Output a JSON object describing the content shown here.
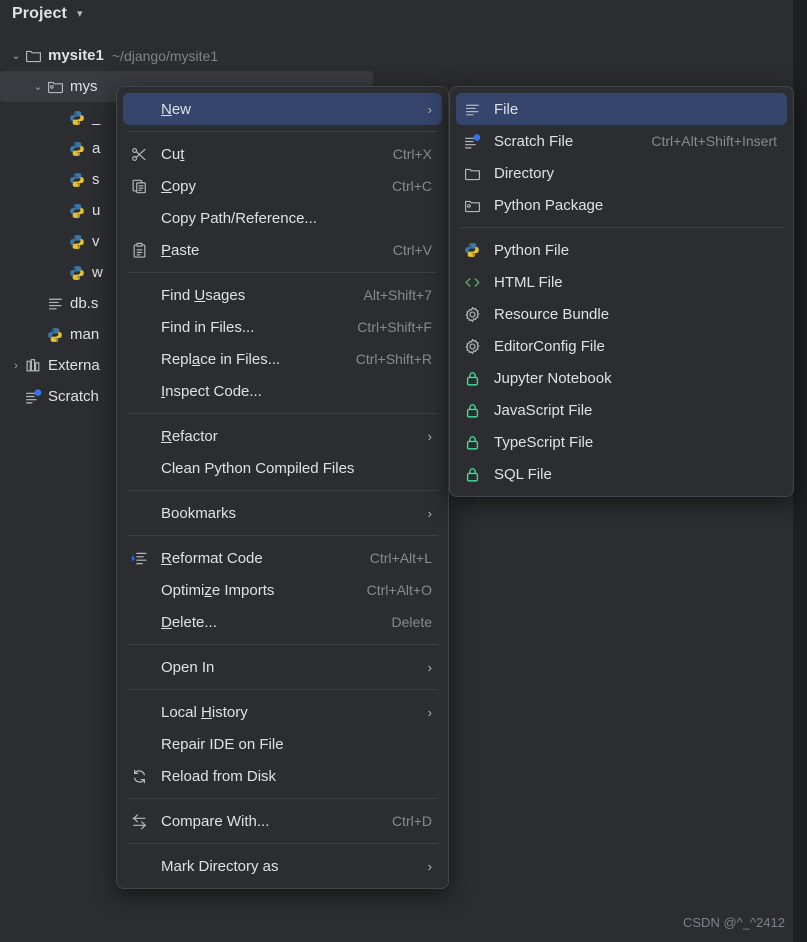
{
  "tool_window": {
    "title": "Project",
    "chevron": "chevron-down-icon"
  },
  "tree": [
    {
      "name": "mysite1",
      "path": "~/django/mysite1",
      "icon": "folder-icon",
      "twist": "expanded",
      "indent": 0,
      "bold": true,
      "selected": false
    },
    {
      "name": "mys",
      "path": "",
      "icon": "package-folder-icon",
      "twist": "expanded",
      "indent": 1,
      "bold": false,
      "selected": true
    },
    {
      "name": "_",
      "path": "",
      "icon": "python-icon",
      "twist": "none",
      "indent": 2,
      "bold": false,
      "selected": false
    },
    {
      "name": "a",
      "path": "",
      "icon": "python-icon",
      "twist": "none",
      "indent": 2,
      "bold": false,
      "selected": false
    },
    {
      "name": "s",
      "path": "",
      "icon": "python-icon",
      "twist": "none",
      "indent": 2,
      "bold": false,
      "selected": false
    },
    {
      "name": "u",
      "path": "",
      "icon": "python-icon",
      "twist": "none",
      "indent": 2,
      "bold": false,
      "selected": false
    },
    {
      "name": "v",
      "path": "",
      "icon": "python-icon",
      "twist": "none",
      "indent": 2,
      "bold": false,
      "selected": false
    },
    {
      "name": "w",
      "path": "",
      "icon": "python-icon",
      "twist": "none",
      "indent": 2,
      "bold": false,
      "selected": false
    },
    {
      "name": "db.s",
      "path": "",
      "icon": "file-lines-icon",
      "twist": "none",
      "indent": 1,
      "bold": false,
      "selected": false
    },
    {
      "name": "man",
      "path": "",
      "icon": "python-icon",
      "twist": "none",
      "indent": 1,
      "bold": false,
      "selected": false
    },
    {
      "name": "Externa",
      "path": "",
      "icon": "library-icon",
      "twist": "collapsed",
      "indent": 0,
      "bold": false,
      "selected": false
    },
    {
      "name": "Scratch",
      "path": "",
      "icon": "scratch-icon",
      "twist": "none",
      "indent": 0,
      "bold": false,
      "selected": false
    }
  ],
  "context_menu": [
    {
      "kind": "item",
      "label": "New",
      "mnemonic": "N",
      "icon": "",
      "shortcut": "",
      "arrow": true,
      "highlighted": true
    },
    {
      "kind": "separator"
    },
    {
      "kind": "item",
      "label": "Cut",
      "mnemonic": "t",
      "icon": "scissors-icon",
      "shortcut": "Ctrl+X",
      "arrow": false,
      "highlighted": false
    },
    {
      "kind": "item",
      "label": "Copy",
      "mnemonic": "C",
      "icon": "copy-icon",
      "shortcut": "Ctrl+C",
      "arrow": false,
      "highlighted": false
    },
    {
      "kind": "item",
      "label": "Copy Path/Reference...",
      "mnemonic": "",
      "icon": "",
      "shortcut": "",
      "arrow": false,
      "highlighted": false
    },
    {
      "kind": "item",
      "label": "Paste",
      "mnemonic": "P",
      "icon": "clipboard-icon",
      "shortcut": "Ctrl+V",
      "arrow": false,
      "highlighted": false
    },
    {
      "kind": "separator"
    },
    {
      "kind": "item",
      "label": "Find Usages",
      "mnemonic": "U",
      "icon": "",
      "shortcut": "Alt+Shift+7",
      "arrow": false,
      "highlighted": false
    },
    {
      "kind": "item",
      "label": "Find in Files...",
      "mnemonic": "",
      "icon": "",
      "shortcut": "Ctrl+Shift+F",
      "arrow": false,
      "highlighted": false
    },
    {
      "kind": "item",
      "label": "Replace in Files...",
      "mnemonic": "a",
      "icon": "",
      "shortcut": "Ctrl+Shift+R",
      "arrow": false,
      "highlighted": false
    },
    {
      "kind": "item",
      "label": "Inspect Code...",
      "mnemonic": "I",
      "icon": "",
      "shortcut": "",
      "arrow": false,
      "highlighted": false
    },
    {
      "kind": "separator"
    },
    {
      "kind": "item",
      "label": "Refactor",
      "mnemonic": "R",
      "icon": "",
      "shortcut": "",
      "arrow": true,
      "highlighted": false
    },
    {
      "kind": "item",
      "label": "Clean Python Compiled Files",
      "mnemonic": "",
      "icon": "",
      "shortcut": "",
      "arrow": false,
      "highlighted": false
    },
    {
      "kind": "separator"
    },
    {
      "kind": "item",
      "label": "Bookmarks",
      "mnemonic": "",
      "icon": "",
      "shortcut": "",
      "arrow": true,
      "highlighted": false
    },
    {
      "kind": "separator"
    },
    {
      "kind": "item",
      "label": "Reformat Code",
      "mnemonic": "R",
      "icon": "reformat-icon",
      "shortcut": "Ctrl+Alt+L",
      "arrow": false,
      "highlighted": false
    },
    {
      "kind": "item",
      "label": "Optimize Imports",
      "mnemonic": "z",
      "icon": "",
      "shortcut": "Ctrl+Alt+O",
      "arrow": false,
      "highlighted": false
    },
    {
      "kind": "item",
      "label": "Delete...",
      "mnemonic": "D",
      "icon": "",
      "shortcut": "Delete",
      "arrow": false,
      "highlighted": false
    },
    {
      "kind": "separator"
    },
    {
      "kind": "item",
      "label": "Open In",
      "mnemonic": "",
      "icon": "",
      "shortcut": "",
      "arrow": true,
      "highlighted": false
    },
    {
      "kind": "separator"
    },
    {
      "kind": "item",
      "label": "Local History",
      "mnemonic": "H",
      "icon": "",
      "shortcut": "",
      "arrow": true,
      "highlighted": false
    },
    {
      "kind": "item",
      "label": "Repair IDE on File",
      "mnemonic": "",
      "icon": "",
      "shortcut": "",
      "arrow": false,
      "highlighted": false
    },
    {
      "kind": "item",
      "label": "Reload from Disk",
      "mnemonic": "",
      "icon": "reload-icon",
      "shortcut": "",
      "arrow": false,
      "highlighted": false
    },
    {
      "kind": "separator"
    },
    {
      "kind": "item",
      "label": "Compare With...",
      "mnemonic": "",
      "icon": "compare-icon",
      "shortcut": "Ctrl+D",
      "arrow": false,
      "highlighted": false
    },
    {
      "kind": "separator"
    },
    {
      "kind": "item",
      "label": "Mark Directory as",
      "mnemonic": "",
      "icon": "",
      "shortcut": "",
      "arrow": true,
      "highlighted": false
    }
  ],
  "new_submenu": [
    {
      "kind": "item",
      "label": "File",
      "icon": "file-lines-icon",
      "shortcut": "",
      "highlighted": true
    },
    {
      "kind": "item",
      "label": "Scratch File",
      "icon": "scratch-icon",
      "shortcut": "Ctrl+Alt+Shift+Insert",
      "highlighted": false
    },
    {
      "kind": "item",
      "label": "Directory",
      "icon": "folder-icon",
      "shortcut": "",
      "highlighted": false
    },
    {
      "kind": "item",
      "label": "Python Package",
      "icon": "package-folder-icon",
      "shortcut": "",
      "highlighted": false
    },
    {
      "kind": "separator"
    },
    {
      "kind": "item",
      "label": "Python File",
      "icon": "python-icon",
      "shortcut": "",
      "highlighted": false
    },
    {
      "kind": "item",
      "label": "HTML File",
      "icon": "html-icon",
      "shortcut": "",
      "highlighted": false
    },
    {
      "kind": "item",
      "label": "Resource Bundle",
      "icon": "gear-icon",
      "shortcut": "",
      "highlighted": false
    },
    {
      "kind": "item",
      "label": "EditorConfig File",
      "icon": "gear-icon",
      "shortcut": "",
      "highlighted": false
    },
    {
      "kind": "item",
      "label": "Jupyter Notebook",
      "icon": "lock-icon",
      "shortcut": "",
      "highlighted": false
    },
    {
      "kind": "item",
      "label": "JavaScript File",
      "icon": "lock-icon",
      "shortcut": "",
      "highlighted": false
    },
    {
      "kind": "item",
      "label": "TypeScript File",
      "icon": "lock-icon",
      "shortcut": "",
      "highlighted": false
    },
    {
      "kind": "item",
      "label": "SQL File",
      "icon": "lock-icon",
      "shortcut": "",
      "highlighted": false
    }
  ],
  "watermark": "CSDN @^_^2412",
  "colors": {
    "background": "#2b2d30",
    "menu_background": "#2b2d30",
    "highlight": "#35456b",
    "text": "#dfe1e5",
    "muted_text": "#868a91",
    "python_blue": "#3c78aa",
    "python_yellow": "#e5c02f",
    "lock_green": "#3ddc97",
    "html_green": "#5aa86f",
    "right_strip": "#1e1f22",
    "selected_row": "#393b40"
  }
}
